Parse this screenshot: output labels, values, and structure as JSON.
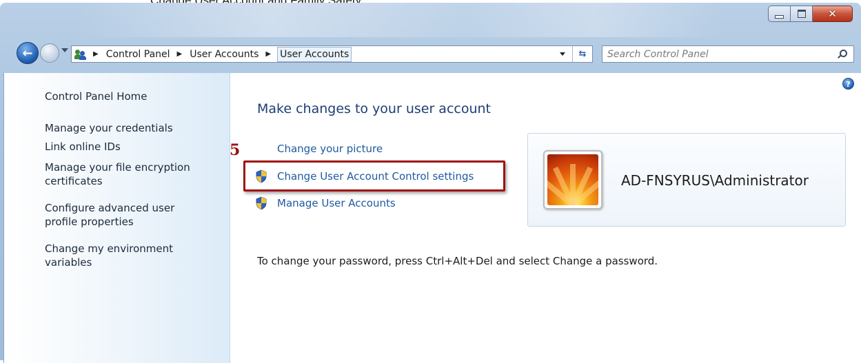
{
  "caption": "Change User Account and Family Safety",
  "window": {
    "buttons": {
      "minimize": "minimize",
      "maximize": "maximize",
      "close": "close"
    }
  },
  "nav": {
    "breadcrumb": [
      "Control Panel",
      "User Accounts",
      "User Accounts"
    ],
    "search_placeholder": "Search Control Panel"
  },
  "sidebar": {
    "items": [
      {
        "label": "Control Panel Home"
      },
      {
        "label": "Manage your credentials"
      },
      {
        "label": "Link online IDs"
      },
      {
        "label": "Manage your file encryption certificates"
      },
      {
        "label": "Configure advanced user profile properties"
      },
      {
        "label": "Change my environment variables"
      }
    ]
  },
  "main": {
    "title": "Make changes to your user account",
    "step_number": "5",
    "tasks": [
      {
        "label": "Change your picture",
        "icon": null
      },
      {
        "label": "Change User Account Control settings",
        "icon": "uac-shield-icon"
      },
      {
        "label": "Manage User Accounts",
        "icon": "uac-shield-icon"
      }
    ],
    "account_name": "AD-FNSYRUS\\Administrator",
    "password_hint": "To change your password, press Ctrl+Alt+Del and select Change a password."
  },
  "colors": {
    "link": "#1e5aa0",
    "title": "#1e3e73",
    "highlight": "#a11010"
  }
}
